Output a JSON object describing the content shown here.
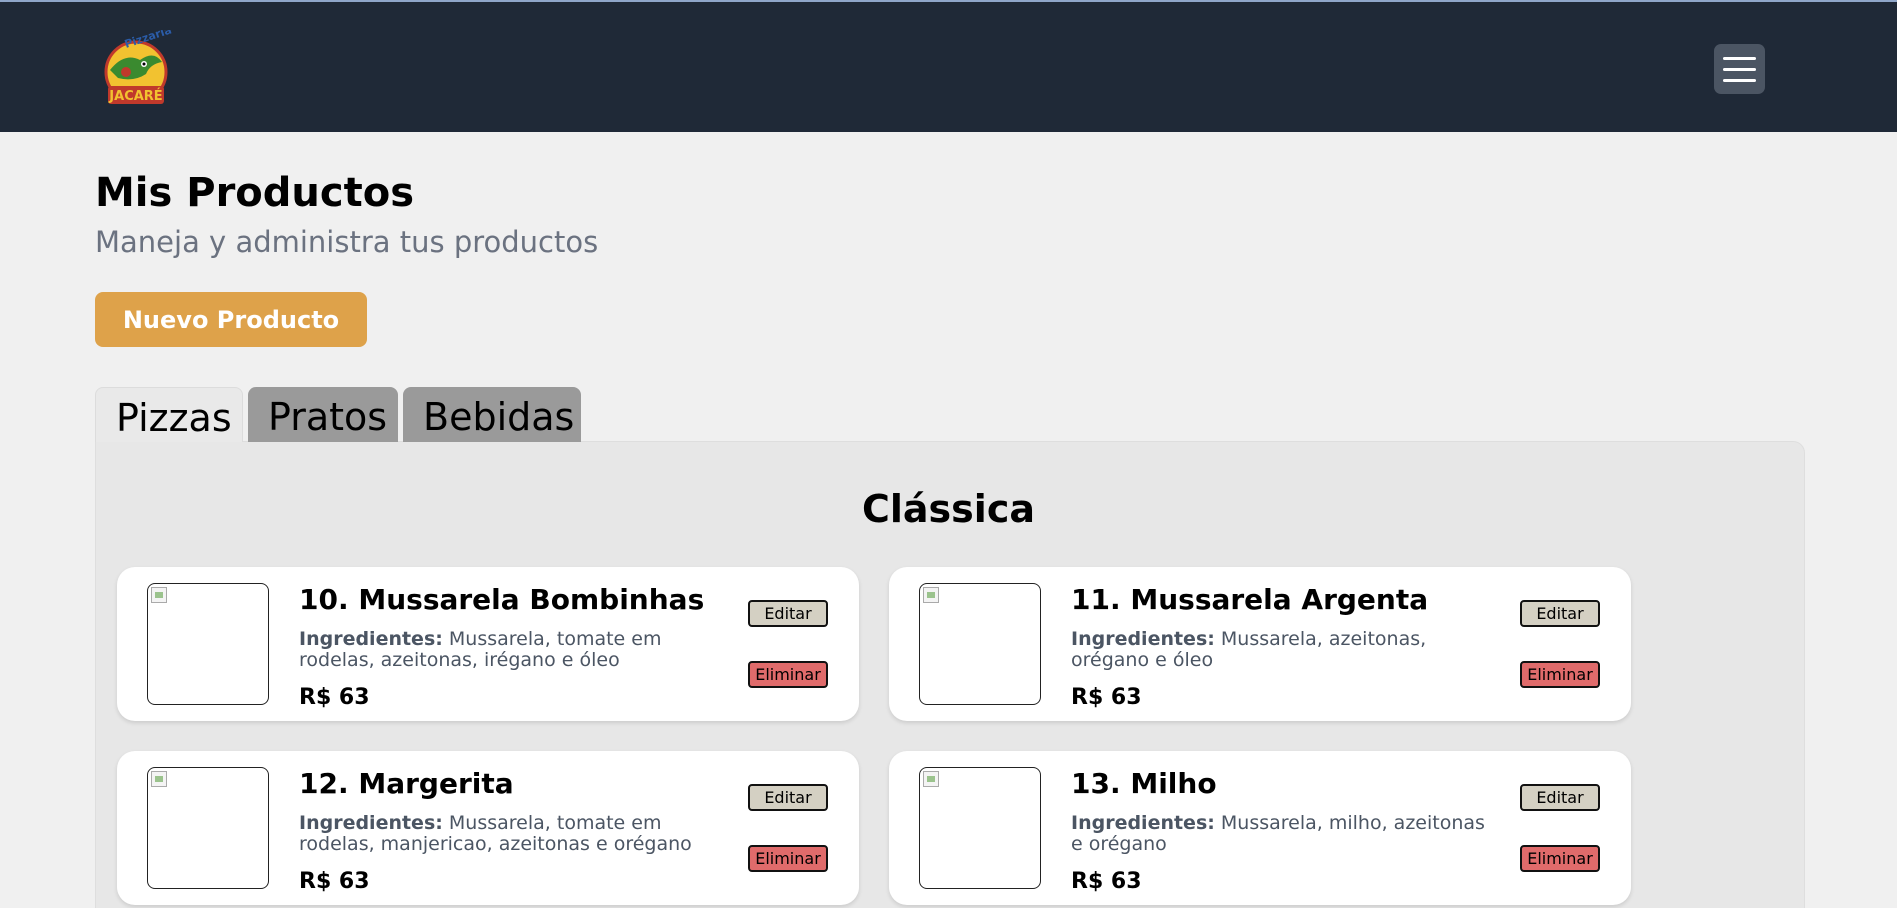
{
  "header": {
    "logo_text_top": "Pizzaria",
    "logo_text_bottom": "JACARÉ"
  },
  "page": {
    "title": "Mis Productos",
    "subtitle": "Maneja y administra tus productos",
    "new_button": "Nuevo Producto"
  },
  "tabs": [
    {
      "label": "Pizzas",
      "active": true
    },
    {
      "label": "Pratos",
      "active": false
    },
    {
      "label": "Bebidas",
      "active": false
    }
  ],
  "section": {
    "title": "Clássica",
    "ingredients_label": "Ingredientes:",
    "edit_label": "Editar",
    "delete_label": "Eliminar"
  },
  "products": [
    {
      "name": "10. Mussarela Bombinhas",
      "ingredients": "Mussarela, tomate em rodelas, azeitonas, irégano e óleo",
      "price": "R$ 63"
    },
    {
      "name": "11. Mussarela Argenta",
      "ingredients": "Mussarela, azeitonas, orégano e óleo",
      "price": "R$ 63"
    },
    {
      "name": "12. Margerita",
      "ingredients": "Mussarela, tomate em rodelas, manjericao, azeitonas e orégano",
      "price": "R$ 63"
    },
    {
      "name": "13. Milho",
      "ingredients": "Mussarela, milho, azeitonas e orégano",
      "price": "R$ 63"
    }
  ],
  "colors": {
    "navbar": "#1f2937",
    "accent": "#dea24a",
    "edit_button": "#d4d0c3",
    "delete_button": "#e06b6b"
  }
}
